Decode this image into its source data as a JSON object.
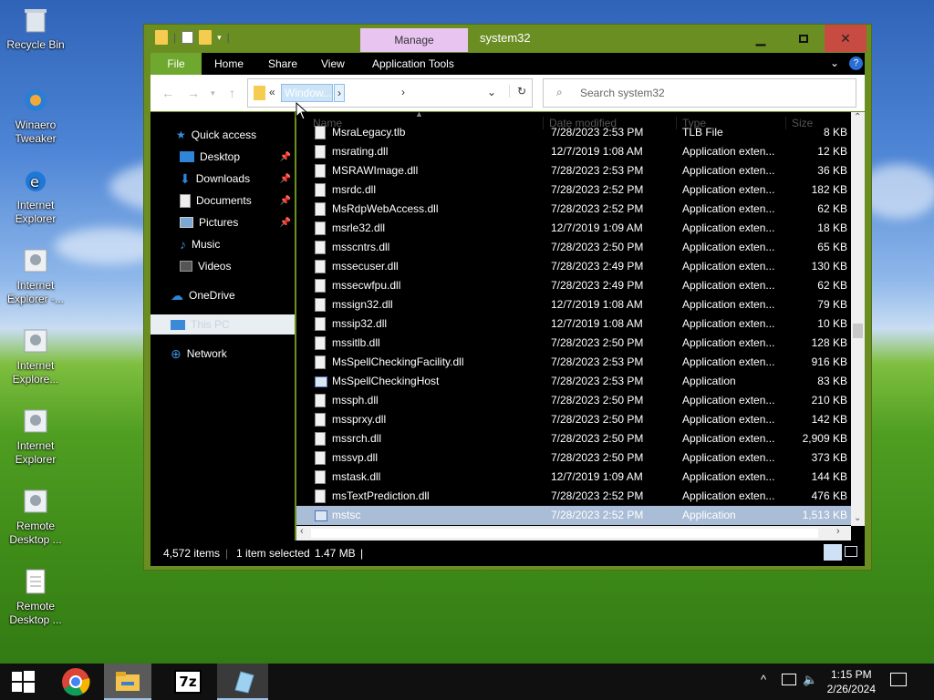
{
  "desktop": {
    "icons": [
      {
        "label": "Recycle Bin"
      },
      {
        "label": "Winaero Tweaker"
      },
      {
        "label": "Internet Explorer"
      },
      {
        "label": "Internet Explorer -..."
      },
      {
        "label": "Internet Explore..."
      },
      {
        "label": "Internet Explorer"
      },
      {
        "label": "Remote Desktop ..."
      },
      {
        "label": "Remote Desktop ..."
      }
    ]
  },
  "window": {
    "title": "system32",
    "manage_tab": "Manage",
    "ribbon_tabs": [
      "File",
      "Home",
      "Share",
      "View",
      "Application Tools"
    ],
    "address": {
      "prefix": "«",
      "segment": "Window..."
    },
    "search_placeholder": "Search system32",
    "columns": {
      "name": "Name",
      "date": "Date modified",
      "type": "Type",
      "size": "Size"
    },
    "nav": {
      "quick_access": "Quick access",
      "desktop": "Desktop",
      "downloads": "Downloads",
      "documents": "Documents",
      "pictures": "Pictures",
      "music": "Music",
      "videos": "Videos",
      "onedrive": "OneDrive",
      "this_pc": "This PC",
      "network": "Network"
    },
    "files": [
      {
        "name": "MsraLegacy.tlb",
        "date": "7/28/2023 2:53 PM",
        "type": "TLB File",
        "size": "8 KB",
        "kind": "dll",
        "selected": false
      },
      {
        "name": "msrating.dll",
        "date": "12/7/2019 1:08 AM",
        "type": "Application exten...",
        "size": "12 KB",
        "kind": "dll",
        "selected": false
      },
      {
        "name": "MSRAWImage.dll",
        "date": "7/28/2023 2:53 PM",
        "type": "Application exten...",
        "size": "36 KB",
        "kind": "dll",
        "selected": false
      },
      {
        "name": "msrdc.dll",
        "date": "7/28/2023 2:52 PM",
        "type": "Application exten...",
        "size": "182 KB",
        "kind": "dll",
        "selected": false
      },
      {
        "name": "MsRdpWebAccess.dll",
        "date": "7/28/2023 2:52 PM",
        "type": "Application exten...",
        "size": "62 KB",
        "kind": "dll",
        "selected": false
      },
      {
        "name": "msrle32.dll",
        "date": "12/7/2019 1:09 AM",
        "type": "Application exten...",
        "size": "18 KB",
        "kind": "dll",
        "selected": false
      },
      {
        "name": "msscntrs.dll",
        "date": "7/28/2023 2:50 PM",
        "type": "Application exten...",
        "size": "65 KB",
        "kind": "dll",
        "selected": false
      },
      {
        "name": "mssecuser.dll",
        "date": "7/28/2023 2:49 PM",
        "type": "Application exten...",
        "size": "130 KB",
        "kind": "dll",
        "selected": false
      },
      {
        "name": "mssecwfpu.dll",
        "date": "7/28/2023 2:49 PM",
        "type": "Application exten...",
        "size": "62 KB",
        "kind": "dll",
        "selected": false
      },
      {
        "name": "mssign32.dll",
        "date": "12/7/2019 1:08 AM",
        "type": "Application exten...",
        "size": "79 KB",
        "kind": "dll",
        "selected": false
      },
      {
        "name": "mssip32.dll",
        "date": "12/7/2019 1:08 AM",
        "type": "Application exten...",
        "size": "10 KB",
        "kind": "dll",
        "selected": false
      },
      {
        "name": "mssitlb.dll",
        "date": "7/28/2023 2:50 PM",
        "type": "Application exten...",
        "size": "128 KB",
        "kind": "dll",
        "selected": false
      },
      {
        "name": "MsSpellCheckingFacility.dll",
        "date": "7/28/2023 2:53 PM",
        "type": "Application exten...",
        "size": "916 KB",
        "kind": "dll",
        "selected": false
      },
      {
        "name": "MsSpellCheckingHost",
        "date": "7/28/2023 2:53 PM",
        "type": "Application",
        "size": "83 KB",
        "kind": "app",
        "selected": false
      },
      {
        "name": "mssph.dll",
        "date": "7/28/2023 2:50 PM",
        "type": "Application exten...",
        "size": "210 KB",
        "kind": "dll",
        "selected": false
      },
      {
        "name": "mssprxy.dll",
        "date": "7/28/2023 2:50 PM",
        "type": "Application exten...",
        "size": "142 KB",
        "kind": "dll",
        "selected": false
      },
      {
        "name": "mssrch.dll",
        "date": "7/28/2023 2:50 PM",
        "type": "Application exten...",
        "size": "2,909 KB",
        "kind": "dll",
        "selected": false
      },
      {
        "name": "mssvp.dll",
        "date": "7/28/2023 2:50 PM",
        "type": "Application exten...",
        "size": "373 KB",
        "kind": "dll",
        "selected": false
      },
      {
        "name": "mstask.dll",
        "date": "12/7/2019 1:09 AM",
        "type": "Application exten...",
        "size": "144 KB",
        "kind": "dll",
        "selected": false
      },
      {
        "name": "msTextPrediction.dll",
        "date": "7/28/2023 2:52 PM",
        "type": "Application exten...",
        "size": "476 KB",
        "kind": "dll",
        "selected": false
      },
      {
        "name": "mstsc",
        "date": "7/28/2023 2:52 PM",
        "type": "Application",
        "size": "1,513 KB",
        "kind": "app",
        "selected": true
      }
    ],
    "status": {
      "count": "4,572 items",
      "selected": "1 item selected",
      "size": "1.47 MB"
    }
  },
  "taskbar": {
    "time": "1:15 PM",
    "date": "2/26/2024"
  },
  "colors": {
    "frame": "#6b8e23",
    "file_tab": "#6fa82f",
    "manage_tab": "#e8c5f0",
    "close": "#c84b42",
    "selection": "#a9bdd6"
  }
}
